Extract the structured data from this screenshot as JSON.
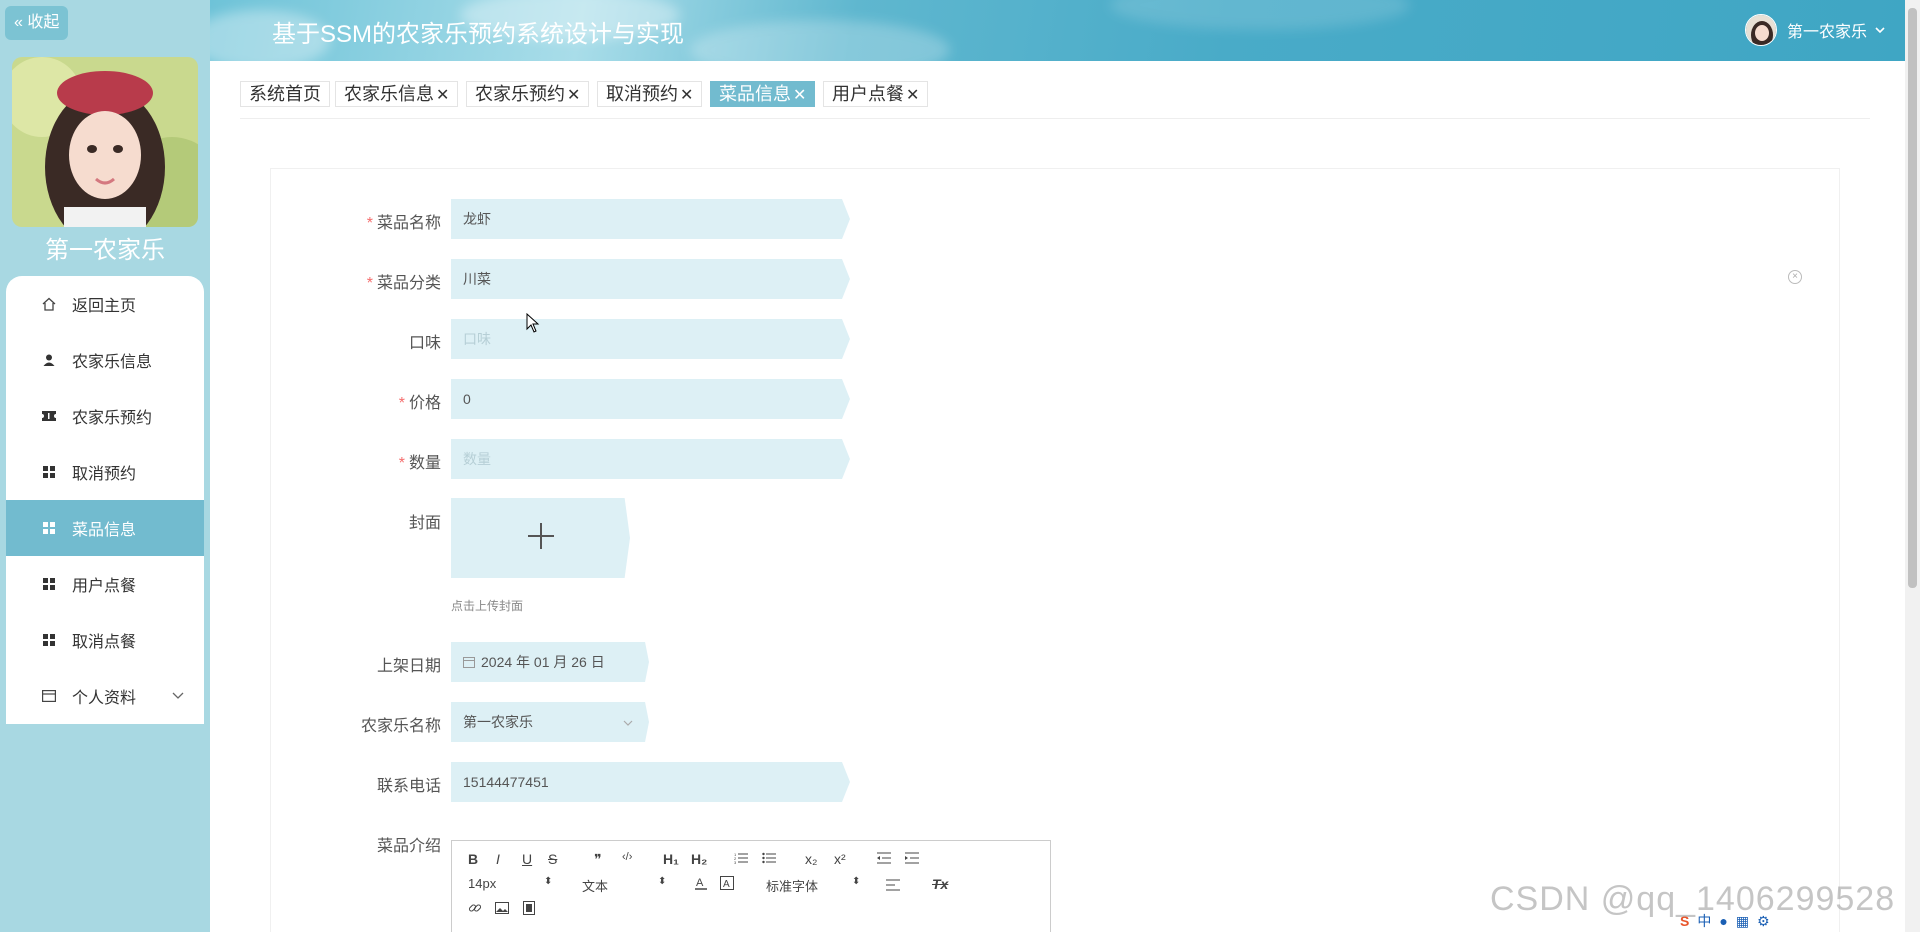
{
  "sidebar": {
    "collapse_label": "« 收起",
    "name": "第一农家乐",
    "menu": [
      {
        "label": "返回主页",
        "icon": "home-icon"
      },
      {
        "label": "农家乐信息",
        "icon": "user-icon"
      },
      {
        "label": "农家乐预约",
        "icon": "ticket-icon"
      },
      {
        "label": "取消预约",
        "icon": "grid-icon"
      },
      {
        "label": "菜品信息",
        "icon": "grid-icon",
        "active": true
      },
      {
        "label": "用户点餐",
        "icon": "grid-icon"
      },
      {
        "label": "取消点餐",
        "icon": "grid-icon"
      },
      {
        "label": "个人资料",
        "icon": "profile-icon"
      }
    ]
  },
  "header": {
    "title": "基于SSM的农家乐预约系统设计与实现",
    "user": "第一农家乐"
  },
  "tabs": [
    {
      "label": "系统首页",
      "closable": false
    },
    {
      "label": "农家乐信息",
      "closable": true
    },
    {
      "label": "农家乐预约",
      "closable": true
    },
    {
      "label": "取消预约",
      "closable": true
    },
    {
      "label": "菜品信息",
      "closable": true,
      "active": true
    },
    {
      "label": "用户点餐",
      "closable": true
    }
  ],
  "tab_close": "✕",
  "form": {
    "dish_name": {
      "label": "菜品名称",
      "value": "龙虾",
      "required": "*"
    },
    "category": {
      "label": "菜品分类",
      "value": "川菜",
      "required": "*"
    },
    "taste": {
      "label": "口味",
      "placeholder": "口味"
    },
    "price": {
      "label": "价格",
      "value": "0",
      "required": "*"
    },
    "quantity": {
      "label": "数量",
      "placeholder": "数量",
      "required": "*"
    },
    "cover": {
      "label": "封面",
      "tip": "点击上传封面"
    },
    "date": {
      "label": "上架日期",
      "value": "2024 年 01 月 26 日"
    },
    "farm_name": {
      "label": "农家乐名称",
      "value": "第一农家乐"
    },
    "phone": {
      "label": "联系电话",
      "value": "15144477451"
    },
    "intro": {
      "label": "菜品介绍"
    }
  },
  "editor": {
    "bold": "B",
    "italic": "I",
    "underline": "U",
    "strike": "S",
    "quote": "❞",
    "code": "‹/›",
    "h1": "H₁",
    "h2": "H₂",
    "sub": "x₂",
    "sup": "x²",
    "font_size": "14px",
    "paragraph": "文本",
    "font_family": "标准字体",
    "spinner": "⬍",
    "clear_format": "Tx"
  },
  "watermark": "CSDN @qq_1406299528",
  "tray_label": "中",
  "colors": {
    "accent": "#72bbcf",
    "sidebar": "#a8d8e2",
    "input": "#ddf0f5",
    "required": "#f56c6c"
  }
}
